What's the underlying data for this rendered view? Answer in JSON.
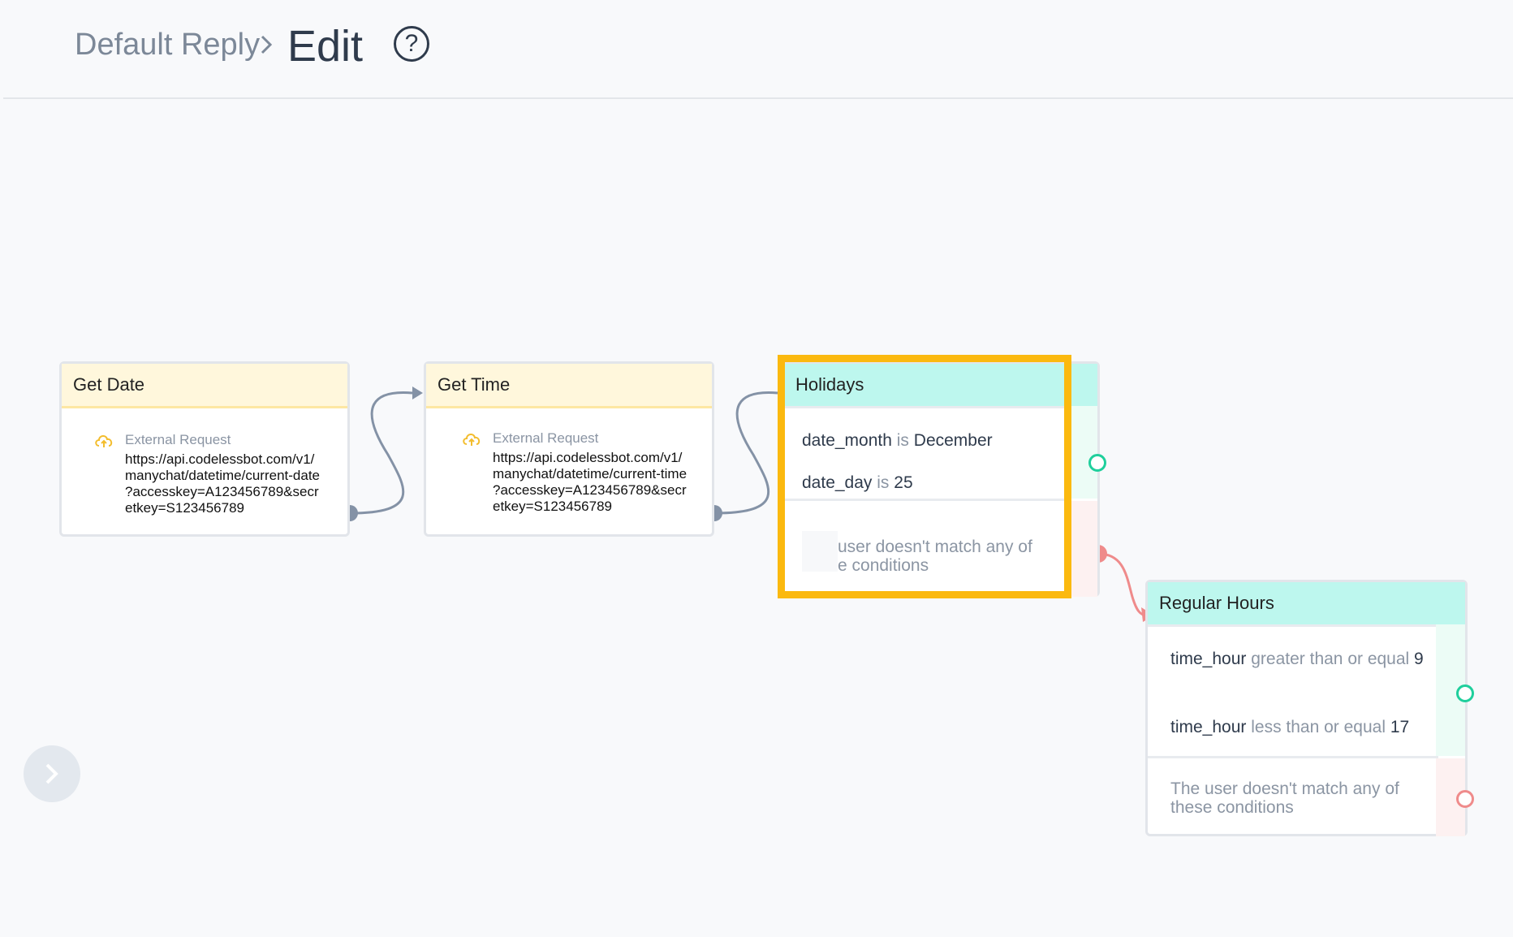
{
  "breadcrumb": {
    "parent": "Default Reply",
    "current": "Edit"
  },
  "help": {
    "glyph": "?"
  },
  "nodes": {
    "get_date": {
      "title": "Get Date",
      "type_label": "External Request",
      "url": "https://api.codelessbot.com/v1/\nmanychat/datetime/current-date\n?accesskey=A123456789&secr\netkey=S123456789"
    },
    "get_time": {
      "title": "Get Time",
      "type_label": "External Request",
      "url": "https://api.codelessbot.com/v1/\nmanychat/datetime/current-time\n?accesskey=A123456789&secr\netkey=S123456789"
    },
    "holidays": {
      "title": "Holidays",
      "conditions": [
        {
          "var": "date_month",
          "op": "is",
          "value": "December"
        },
        {
          "var": "date_day",
          "op": "is",
          "value": "25"
        }
      ],
      "fallback": "user doesn't match any of\nе conditions"
    },
    "regular_hours": {
      "title": "Regular Hours",
      "conditions": [
        {
          "var": "time_hour",
          "op": "greater than or equal",
          "value": "9"
        },
        {
          "var": "time_hour",
          "op": "less than or equal",
          "value": "17"
        }
      ],
      "fallback": "The user doesn't match any of\nthese conditions"
    }
  },
  "highlight": {
    "color": "#fbb90f"
  },
  "colors": {
    "teal_header": "#bdf7ee",
    "yellow_header": "#fff7dc",
    "success_port": "#1fcf9c",
    "fail_port": "#ef8b8b",
    "wire": "#8492a6"
  },
  "icons": {
    "external_request": "cloud-upload-icon",
    "sidebar_toggle": "chevron-right-icon",
    "breadcrumb_separator": "chevron-right-icon"
  }
}
